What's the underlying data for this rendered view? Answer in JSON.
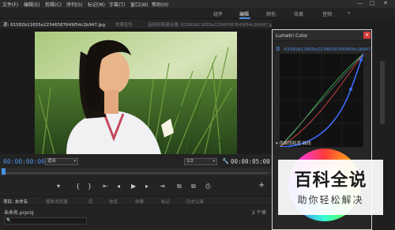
{
  "menu": {
    "items": [
      "文件(F)",
      "编辑(E)",
      "剪辑(C)",
      "序列(S)",
      "标记(M)",
      "字幕(T)",
      "窗口(W)",
      "帮助(H)"
    ],
    "window_min": "—",
    "window_max": "□",
    "window_close": "✕"
  },
  "workspaces": {
    "tabs": [
      "组件",
      "编辑",
      "颜色",
      "效果",
      "音频"
    ],
    "active": "编辑",
    "more": "»"
  },
  "program_monitor": {
    "tab_active": "源: 61582b11655e22346587649f54c2b947.jpg",
    "tab_effects": "效果控件",
    "tab_mixer": "音频剪辑混合器: 61582b11655e22346587649f54c2b947.jpg",
    "timecode_left": "00:00:00:00",
    "fit_label": "适合",
    "scale_label": "1/2",
    "timecode_right": "00:00:05:00"
  },
  "transport": {
    "buttons": [
      "▾",
      "{",
      "}",
      "⇤",
      "◂",
      "▶",
      "▸",
      "⇥",
      "⧉",
      "⧉",
      "⎙",
      "+"
    ]
  },
  "project_panel": {
    "tabs": [
      "项目: 未命名",
      "媒体浏览器",
      "库",
      "信息",
      "效果",
      "标记",
      "历史记录"
    ],
    "file_name": "未命名.prproj",
    "count": "2 个项",
    "search_icon": "🔍"
  },
  "lumetri": {
    "title": "Lumetri Color",
    "clip_label": "源 · 61582b11655e22346587649f54c2b947.jpg",
    "section_label": "▾ 色相饱和度 曲线",
    "close": "✕"
  },
  "watermark": {
    "title": "百科全说",
    "subtitle": "助你轻松解决"
  }
}
